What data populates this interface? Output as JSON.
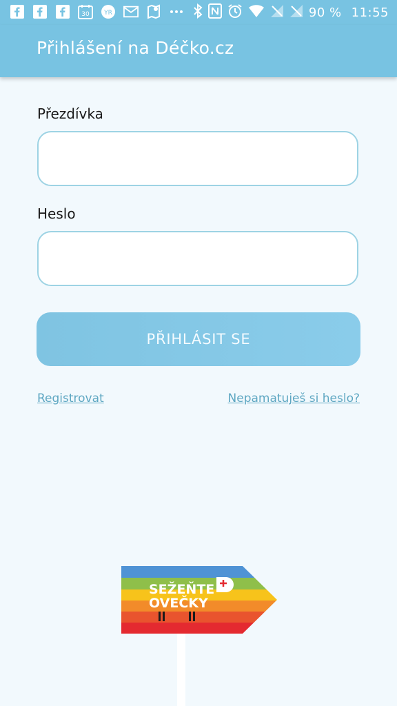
{
  "status_bar": {
    "battery_percent": "90 %",
    "time": "11:55",
    "notification_icons": [
      "facebook-icon",
      "facebook-icon",
      "facebook-icon",
      "calendar-icon",
      "yr-weather-icon",
      "gmail-icon",
      "maps-icon",
      "more-icon"
    ],
    "system_icons": [
      "bluetooth-icon",
      "nfc-icon",
      "alarm-icon",
      "wifi-icon",
      "signal-icon",
      "signal-icon"
    ]
  },
  "app_bar": {
    "title": "Přihlášení na Déčko.cz"
  },
  "form": {
    "nickname_label": "Přezdívka",
    "nickname_value": "",
    "password_label": "Heslo",
    "password_value": "",
    "login_button": "PŘIHLÁSIT SE",
    "register_link": "Registrovat",
    "forgot_link": "Nepamatuješ si heslo?"
  },
  "promo": {
    "line1": "SEŽEŇTE",
    "line2": "OVEČKY",
    "stripe_colors": [
      "#4f93d5",
      "#8fbf4a",
      "#f7c31b",
      "#f28b2a",
      "#e9542e",
      "#e42a30"
    ]
  }
}
